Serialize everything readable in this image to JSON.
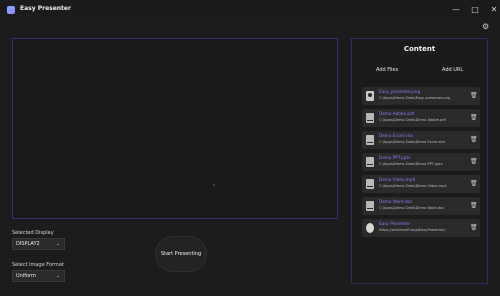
{
  "window": {
    "title": "Easy Presenter",
    "controls": {
      "minimize": "—",
      "maximize": "□",
      "close": "✕"
    },
    "settings_icon": "⚙"
  },
  "left_panel": {
    "selected_display_label": "Selected Display",
    "selected_display_value": "DISPLAY2",
    "image_format_label": "Select Image Format",
    "image_format_value": "Uniform",
    "start_button": "Start Presenting"
  },
  "content_panel": {
    "title": "Content",
    "add_files": "Add Files",
    "add_url": "Add URL",
    "items": [
      {
        "name": "Easy_presenter.png",
        "path": "C:\\Apps\\Demo Data\\Easy presenter.png",
        "icon": "image-icon"
      },
      {
        "name": "Demo Adobe.pdf",
        "path": "C:\\Apps\\Demo Data\\Demo Adobe.pdf",
        "icon": "pdf-icon"
      },
      {
        "name": "Demo Excel.xlsx",
        "path": "C:\\Apps\\Demo Data\\Demo Excel.xlsx",
        "icon": "excel-icon"
      },
      {
        "name": "Demo PPT.pptx",
        "path": "C:\\Apps\\Demo Data\\Demo PPT.pptx",
        "icon": "powerpoint-icon"
      },
      {
        "name": "Demo Video.mp4",
        "path": "C:\\Apps\\Demo Data\\Demo Video.mp4",
        "icon": "video-icon"
      },
      {
        "name": "Demo Word.doc",
        "path": "C:\\Apps\\Demo Data\\Demo Word.doc",
        "icon": "word-icon"
      },
      {
        "name": "Easy Presenter",
        "path": "https://actemsoft.app/EasyPresenter/",
        "icon": "globe-icon"
      }
    ],
    "delete_icon": "🗑"
  },
  "colors": {
    "accent": "#8c7cff",
    "border": "#36295f",
    "background": "#1c1c1c",
    "card": "#2a2a2a"
  }
}
